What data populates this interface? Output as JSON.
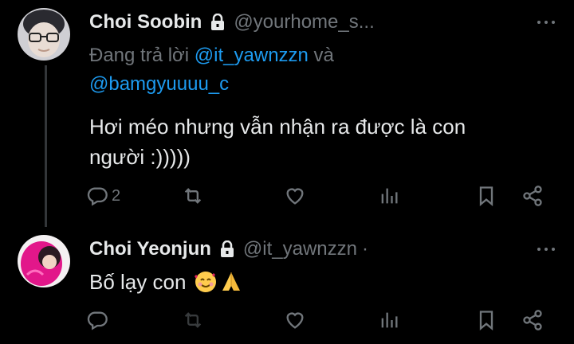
{
  "tweets": [
    {
      "name": "Choi Soobin",
      "handle": "@yourhome_s...",
      "reply_prefix": "Đang trả lời ",
      "reply_mention_1": "@it_yawnzzn",
      "reply_and": " và",
      "reply_mention_2": "@bamgyuuuu_c",
      "text_line1": "Hơi méo nhưng vẫn nhận ra được là con",
      "text_line2": "người :)))))",
      "reply_count": "2",
      "icons": [
        "reply-icon",
        "retweet-icon",
        "like-icon",
        "views-icon",
        "bookmark-icon",
        "share-icon"
      ]
    },
    {
      "name": "Choi Yeonjun",
      "handle": "@it_yawnzzn",
      "separator": "·",
      "text": "Bố lạy con",
      "emojis": [
        "smiling-face-with-hearts",
        "folded-hands"
      ],
      "icons": [
        "reply-icon",
        "retweet-icon",
        "like-icon",
        "views-icon",
        "bookmark-icon",
        "share-icon"
      ]
    }
  ],
  "colors": {
    "background": "#000000",
    "text": "#e7e9ea",
    "muted": "#71767b",
    "link": "#1d9bf0",
    "thread_line": "#333639"
  }
}
